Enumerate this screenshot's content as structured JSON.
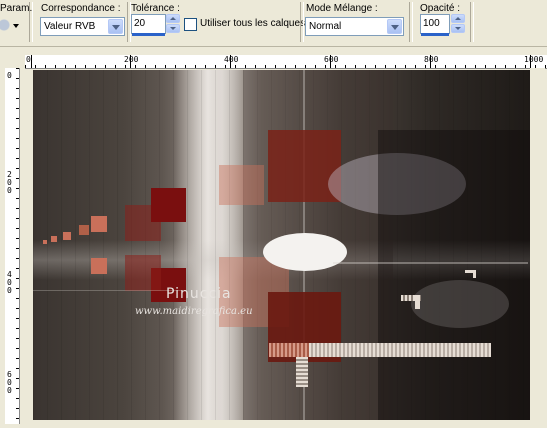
{
  "toolbar": {
    "partial_left_label": "Param.",
    "correspondance_label": "Correspondance :",
    "correspondance_value": "Valeur RVB",
    "tolerance_label": "Tolérance :",
    "tolerance_value": "20",
    "use_all_layers_label": "Utiliser tous les calques",
    "blend_mode_label": "Mode Mélange :",
    "blend_mode_value": "Normal",
    "opacity_label": "Opacité :",
    "opacity_value": "100"
  },
  "ruler": {
    "h_ticks": [
      "0",
      "200",
      "400",
      "600",
      "800",
      "1000"
    ],
    "v_ticks": [
      "0",
      "200",
      "400",
      "600"
    ]
  },
  "canvas": {
    "watermark_title": "Pinuccia",
    "watermark_url": "www.maidiregrafica.eu"
  },
  "colors": {
    "toolbar_bg": "#ece9d8",
    "accent_dark_red": "#7a1410",
    "accent_salmon": "#c9705a",
    "canvas_bg": "#2f2a26"
  }
}
